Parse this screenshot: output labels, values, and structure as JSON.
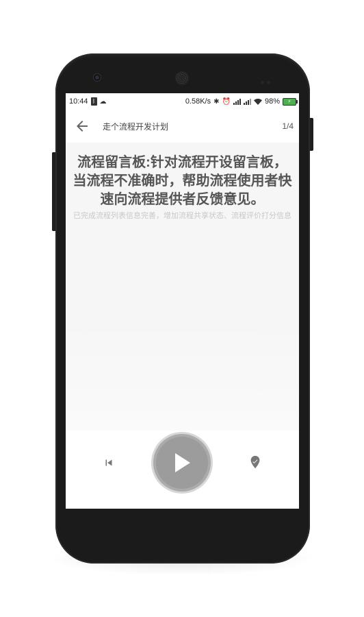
{
  "status_bar": {
    "time": "10:44",
    "network_speed": "0.58K/s",
    "battery_percent": "98%",
    "icons": [
      "bluetooth-icon",
      "cloud-icon",
      "vibrate-icon",
      "alarm-icon",
      "signal-icon",
      "signal-icon",
      "wifi-icon",
      "battery-icon"
    ]
  },
  "toolbar": {
    "back_icon": "arrow-left-icon",
    "title": "走个流程开发计划",
    "page_indicator": "1/4"
  },
  "content": {
    "title": "流程留言板:针对流程开设留言板，当流程不准确时，帮助流程使用者快速向流程提供者反馈意见。",
    "subtitle": "已完成流程列表信息完善，增加流程共享状态、流程评价打分信息"
  },
  "controls": {
    "previous_icon": "skip-previous-icon",
    "play_icon": "play-icon",
    "pin_icon": "location-pin-icon"
  },
  "colors": {
    "phone_body": "#1b1b1b",
    "content_bg": "#f6f6f6",
    "play_button": "#9c9c9c",
    "title_text": "#555555",
    "subtitle_text": "#c8c8c8"
  }
}
